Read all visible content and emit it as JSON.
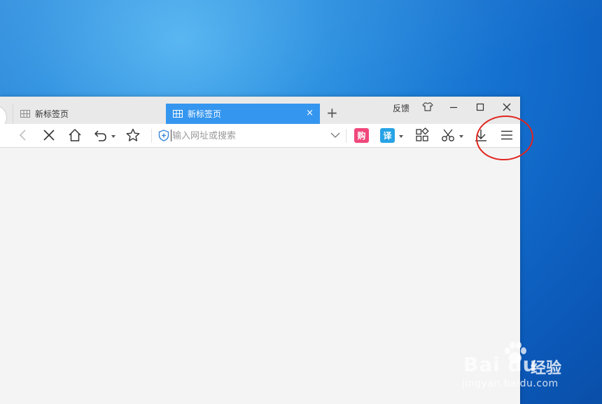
{
  "browser": {
    "tabs": [
      {
        "label": "新标签页",
        "active": false
      },
      {
        "label": "新标签页",
        "active": true
      }
    ],
    "tab_close_glyph": "×",
    "new_tab_glyph": "+",
    "feedback_label": "反馈",
    "address_bar": {
      "placeholder": "输入网址或搜索",
      "value": ""
    },
    "shop_badge": "购",
    "translate_badge": "译",
    "colors": {
      "accent": "#3596ef",
      "shop_badge": "#f0477b",
      "translate_badge": "#27a3e6",
      "annotation": "#e0251f"
    }
  },
  "icons": [
    "back-icon",
    "stop-icon",
    "home-icon",
    "undo-icon",
    "star-icon",
    "shield-icon",
    "dropdown-chevron-icon",
    "apps-icon",
    "scissors-icon",
    "download-icon",
    "menu-icon",
    "skin-icon",
    "minimize-icon",
    "maximize-icon",
    "close-icon"
  ],
  "watermark": {
    "brand": "Bai du",
    "cn": "经验",
    "url": "jingyan.baidu.com"
  }
}
